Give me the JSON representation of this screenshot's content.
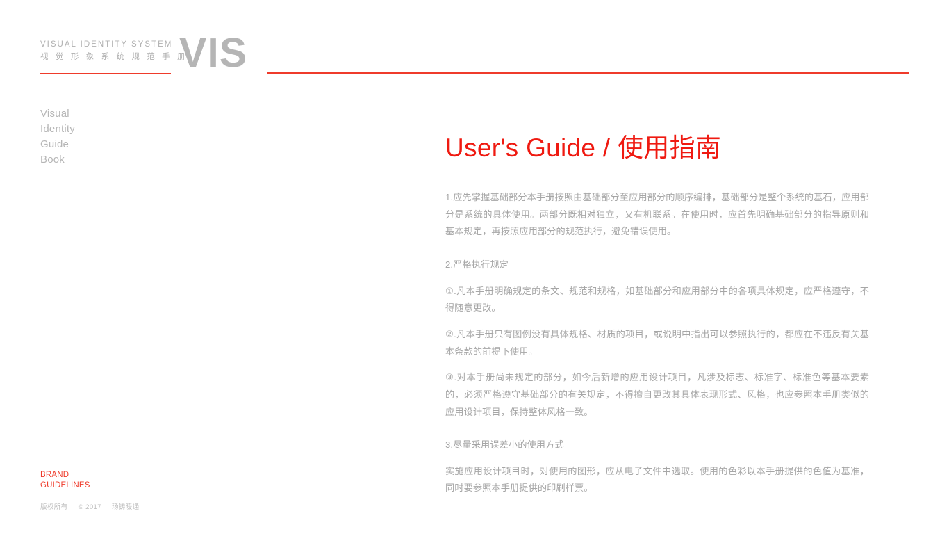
{
  "header": {
    "mark_en": "VISUAL  IDENTITY  SYSTEM",
    "mark_cn": "视 觉 形 象 系 统 规 范 手 册",
    "logo": "VIS",
    "rule_color": "#ef3b2b"
  },
  "sidebar": {
    "items": [
      {
        "label": "Visual"
      },
      {
        "label": "Identity"
      },
      {
        "label": "Guide"
      },
      {
        "label": "Book"
      }
    ]
  },
  "main": {
    "title": "User's Guide / 使用指南",
    "title_color": "#ef1a11",
    "blocks": [
      {
        "lines": [
          "1.应先掌握基础部分本手册按照由基础部分至应用部分的顺序编排，基础部分是整个系统的基石，应用部分是系统的具体使用。两部分既相对独立，又有机联系。在使用时，应首先明确基础部分的指导原则和基本规定，再按照应用部分的规范执行，避免错误使用。"
        ]
      },
      {
        "lines": [
          "2.严格执行规定",
          "①.凡本手册明确规定的条文、规范和规格，如基础部分和应用部分中的各项具体规定，应严格遵守，不得随意更改。",
          "②.凡本手册只有图例没有具体规格、材质的项目，或说明中指出可以参照执行的，都应在不违反有关基本条款的前提下使用。",
          "③.对本手册尚未规定的部分，如今后新增的应用设计项目，凡涉及标志、标准字、标准色等基本要素的，必须严格遵守基础部分的有关规定，不得擅自更改其具体表现形式、风格，也应参照本手册类似的应用设计项目，保持整体风格一致。"
        ]
      },
      {
        "lines": [
          "3.尽量采用误差小的使用方式",
          "实施应用设计项目时，对使用的图形，应从电子文件中选取。使用的色彩以本手册提供的色值为基准，同时要参照本手册提供的印刷样票。"
        ]
      }
    ]
  },
  "footer": {
    "brand_line1": "BRAND",
    "brand_line2": "GUIDELINES",
    "copyright_label": "版权所有",
    "copyright_symbol": "©",
    "copyright_year": "2017",
    "copyright_company": "玚铸暖通",
    "brand_color": "#ef3b2b"
  }
}
